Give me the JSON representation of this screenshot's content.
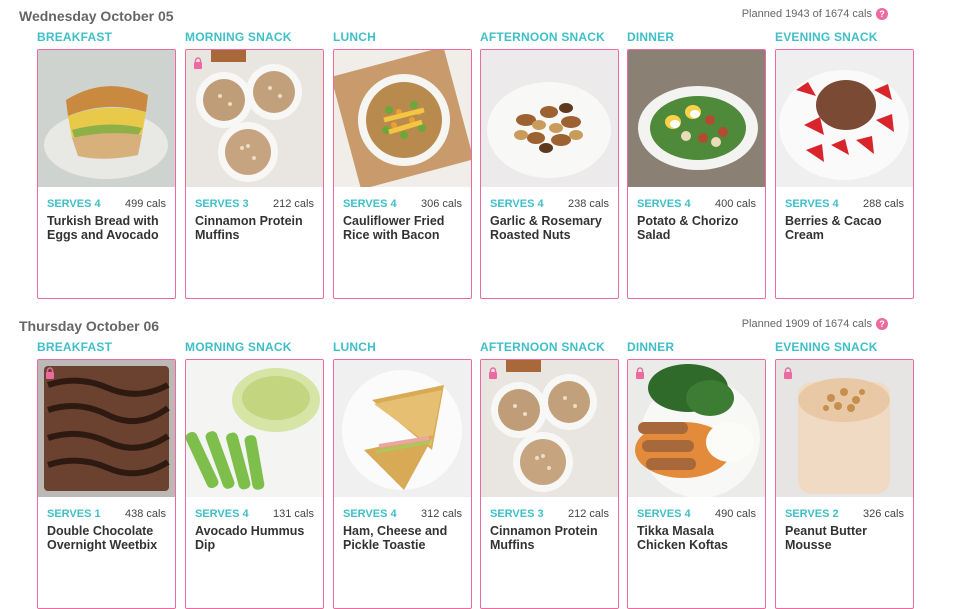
{
  "days": [
    {
      "title": "Wednesday October 05",
      "planned": "Planned 1943 of 1674 cals",
      "help_icon": "?",
      "meals": [
        {
          "label": "BREAKFAST",
          "serves": "SERVES 4",
          "cals": "499 cals",
          "name": "Turkish Bread with Eggs and Avocado",
          "locked": false,
          "image": "sandwich"
        },
        {
          "label": "MORNING SNACK",
          "serves": "SERVES 3",
          "cals": "212 cals",
          "name": "Cinnamon Protein Muffins",
          "locked": true,
          "image": "muffins"
        },
        {
          "label": "LUNCH",
          "serves": "SERVES 4",
          "cals": "306 cals",
          "name": "Cauliflower Fried Rice with Bacon",
          "locked": false,
          "image": "fried-rice"
        },
        {
          "label": "AFTERNOON SNACK",
          "serves": "SERVES 4",
          "cals": "238 cals",
          "name": "Garlic & Rosemary Roasted Nuts",
          "locked": false,
          "image": "nuts"
        },
        {
          "label": "DINNER",
          "serves": "SERVES 4",
          "cals": "400 cals",
          "name": "Potato & Chorizo Salad",
          "locked": false,
          "image": "salad"
        },
        {
          "label": "EVENING SNACK",
          "serves": "SERVES 4",
          "cals": "288 cals",
          "name": "Berries & Cacao Cream",
          "locked": false,
          "image": "berries"
        }
      ]
    },
    {
      "title": "Thursday October 06",
      "planned": "Planned 1909 of 1674 cals",
      "help_icon": "?",
      "meals": [
        {
          "label": "BREAKFAST",
          "serves": "SERVES 1",
          "cals": "438 cals",
          "name": "Double Chocolate Overnight Weetbix",
          "locked": true,
          "image": "chocolate"
        },
        {
          "label": "MORNING SNACK",
          "serves": "SERVES 4",
          "cals": "131 cals",
          "name": "Avocado Hummus Dip",
          "locked": false,
          "image": "hummus"
        },
        {
          "label": "LUNCH",
          "serves": "SERVES 4",
          "cals": "312 cals",
          "name": "Ham, Cheese and Pickle Toastie",
          "locked": false,
          "image": "toastie"
        },
        {
          "label": "AFTERNOON SNACK",
          "serves": "SERVES 3",
          "cals": "212 cals",
          "name": "Cinnamon Protein Muffins",
          "locked": true,
          "image": "muffins"
        },
        {
          "label": "DINNER",
          "serves": "SERVES 4",
          "cals": "490 cals",
          "name": "Tikka Masala Chicken Koftas",
          "locked": true,
          "image": "koftas"
        },
        {
          "label": "EVENING SNACK",
          "serves": "SERVES 2",
          "cals": "326 cals",
          "name": "Peanut Butter Mousse",
          "locked": true,
          "image": "mousse"
        }
      ]
    }
  ],
  "colors": {
    "accent_teal": "#3fbfc7",
    "accent_pink": "#ec6aa0",
    "text": "#333333"
  }
}
